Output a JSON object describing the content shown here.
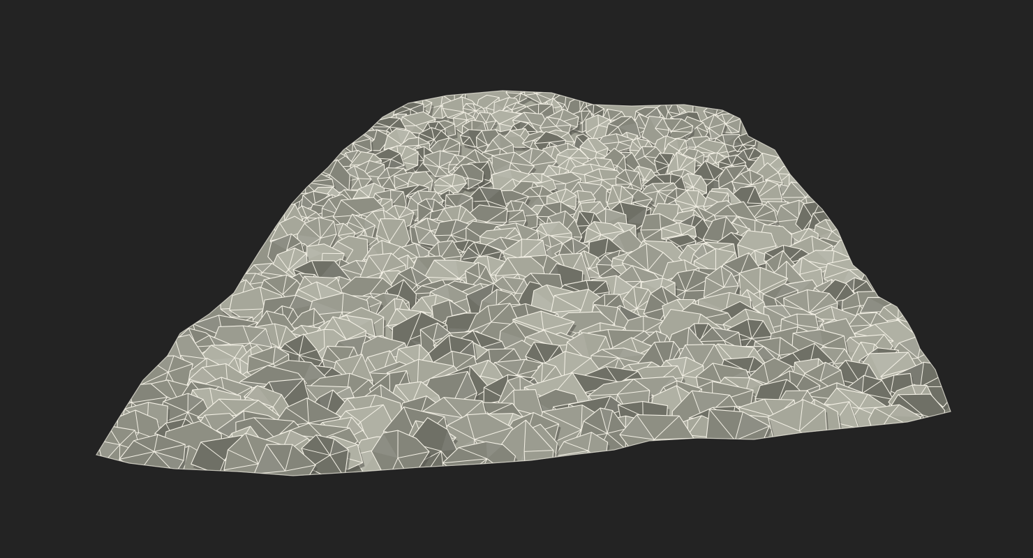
{
  "scene": {
    "subject": "rock-pile-wireframe",
    "colors": {
      "background": "#232323",
      "rock_light": "#a6a79a",
      "rock_mid": "#8e8f83",
      "rock_dark": "#6f7066",
      "shadow": "#55564e",
      "wire": "#f4f1e6"
    }
  }
}
